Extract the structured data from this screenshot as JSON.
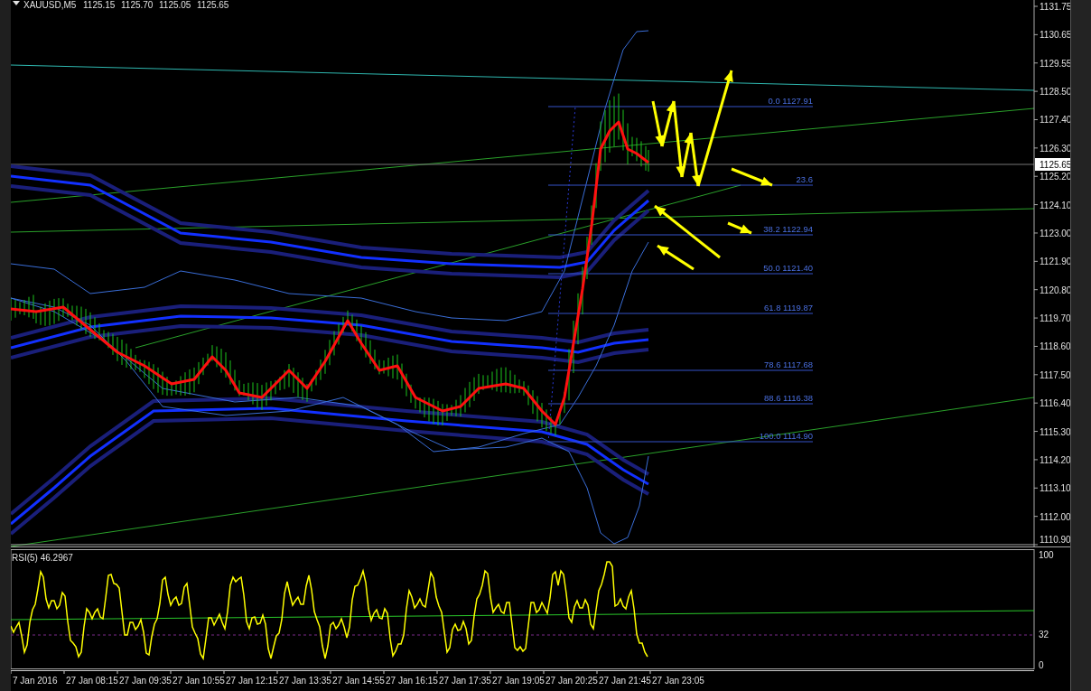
{
  "chart_header": {
    "symbol": "XAUUSD,M5",
    "quotes": [
      "1125.15",
      "1125.70",
      "1125.05",
      "1125.65"
    ]
  },
  "price_axis": {
    "ticks": [
      "1131.75",
      "1130.65",
      "1129.55",
      "1128.50",
      "1127.40",
      "1126.30",
      "1125.20",
      "1124.10",
      "1123.00",
      "1121.90",
      "1120.80",
      "1119.70",
      "1118.60",
      "1117.50",
      "1116.40",
      "1115.30",
      "1114.20",
      "1113.10",
      "1112.00",
      "1110.90"
    ],
    "current_price": "1125.65"
  },
  "fibonacci": {
    "levels": [
      {
        "label": "0.0 1127.91"
      },
      {
        "label": "23.6"
      },
      {
        "label": "38.2 1122.94"
      },
      {
        "label": "50.0 1121.40"
      },
      {
        "label": "61.8 1119.87"
      },
      {
        "label": "78.6 1117.68"
      },
      {
        "label": "88.6 1116.38"
      },
      {
        "label": "100.0 1114.90"
      }
    ]
  },
  "rsi": {
    "label": "RSI(5) 46.2967",
    "ticks": [
      "100",
      "32",
      "0"
    ]
  },
  "time_axis": {
    "labels": [
      "7 Jan 2016",
      "27 Jan 08:15",
      "27 Jan 09:35",
      "27 Jan 10:55",
      "27 Jan 12:15",
      "27 Jan 13:35",
      "27 Jan 14:55",
      "27 Jan 16:15",
      "27 Jan 17:35",
      "27 Jan 19:05",
      "27 Jan 20:25",
      "27 Jan 21:45",
      "27 Jan 23:05"
    ]
  }
}
